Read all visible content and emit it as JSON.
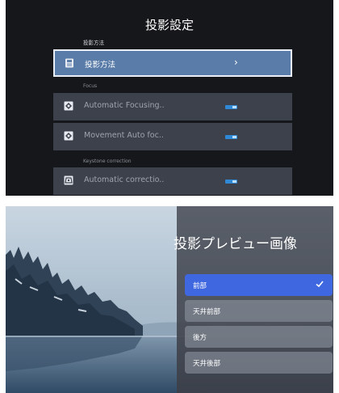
{
  "settings": {
    "title": "投影設定",
    "sections": [
      {
        "label": "投影方法"
      },
      {
        "label": "Focus"
      },
      {
        "label": "Keystone correction"
      }
    ],
    "rows": [
      {
        "label": "投影方法",
        "icon": "projector-icon",
        "control": "chevron",
        "chevron": "›"
      },
      {
        "label": "Automatic Focusing..",
        "icon": "focus-icon",
        "control": "toggle",
        "on": true
      },
      {
        "label": "Movement Auto foc..",
        "icon": "focus-icon",
        "control": "toggle",
        "on": true
      },
      {
        "label": "Automatic correctio..",
        "icon": "keystone-icon",
        "control": "toggle",
        "on": true
      }
    ],
    "colors": {
      "background": "#16171b",
      "row": "#3d414c",
      "focused_row": "#5a7ca8",
      "toggle": "#2f89d6"
    }
  },
  "preview": {
    "title": "投影プレビュー画像",
    "options": [
      {
        "label": "前部",
        "selected": true
      },
      {
        "label": "天井前部",
        "selected": false
      },
      {
        "label": "後方",
        "selected": false
      },
      {
        "label": "天井後部",
        "selected": false
      }
    ],
    "colors": {
      "selected": "#3f67e0",
      "option": "#969ca8"
    }
  }
}
